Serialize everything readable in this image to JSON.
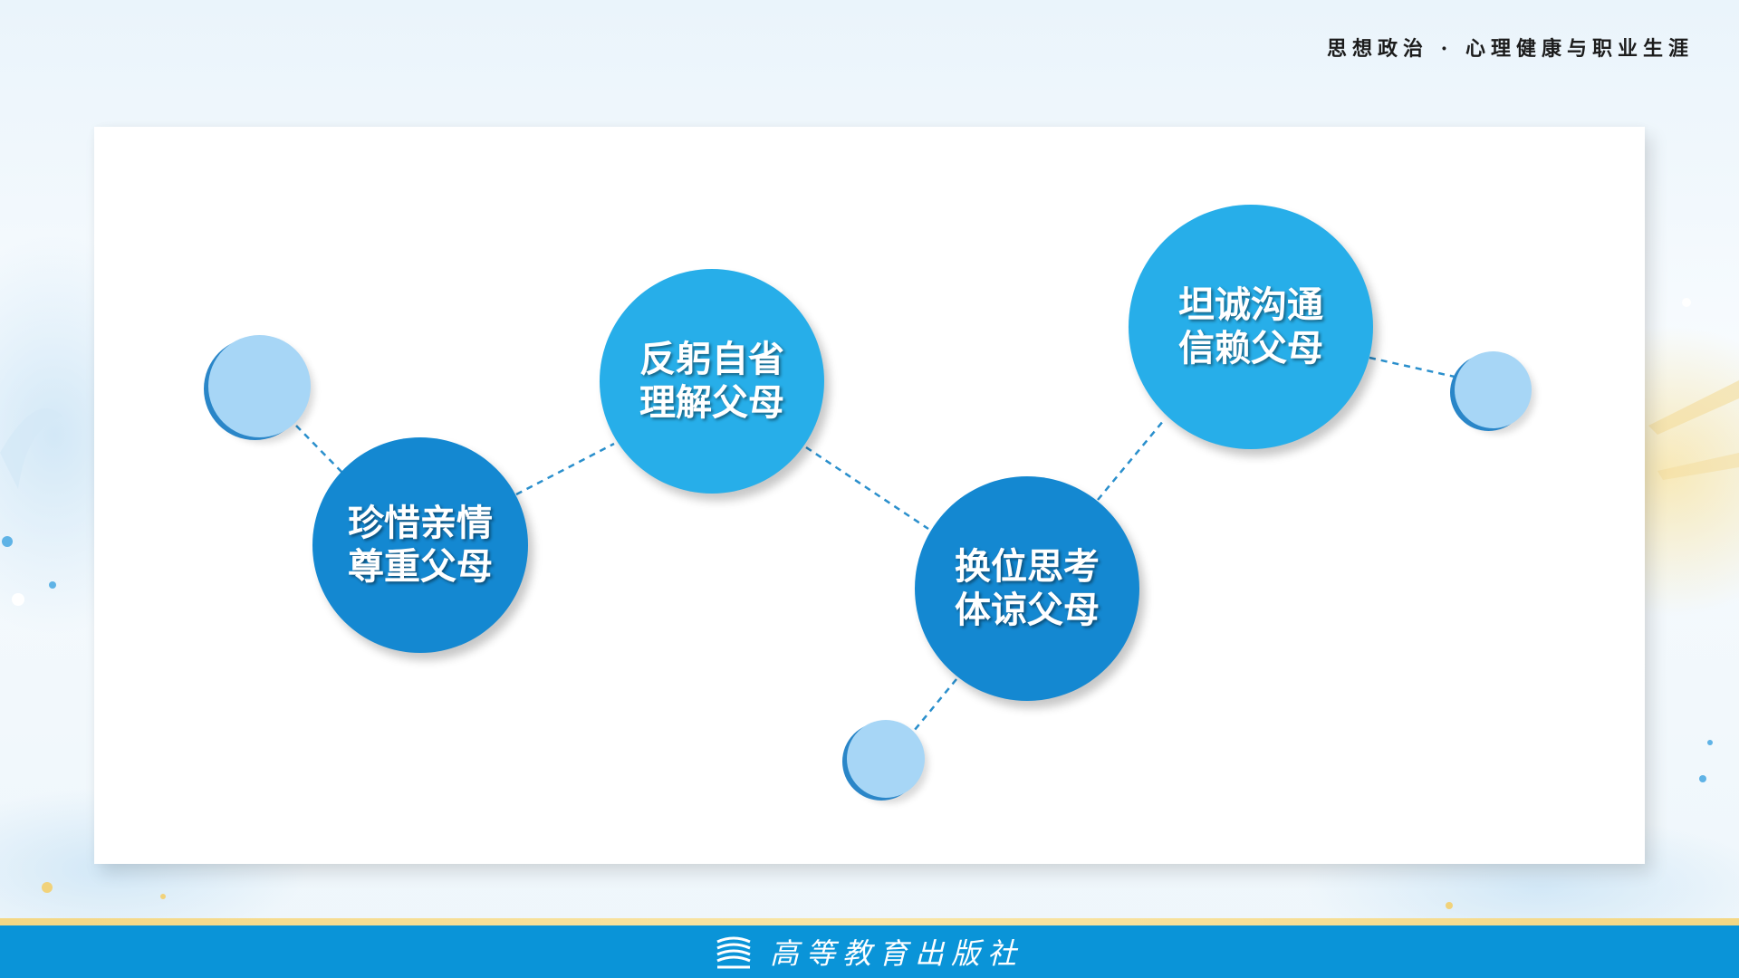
{
  "header": {
    "title": "思想政治 · 心理健康与职业生涯"
  },
  "nodes": [
    {
      "id": "cherish",
      "line1": "珍惜亲情",
      "line2": "尊重父母"
    },
    {
      "id": "reflect",
      "line1": "反躬自省",
      "line2": "理解父母"
    },
    {
      "id": "empathy",
      "line1": "换位思考",
      "line2": "体谅父母"
    },
    {
      "id": "communicate",
      "line1": "坦诚沟通",
      "line2": "信赖父母"
    }
  ],
  "footer": {
    "publisher": "高等教育出版社"
  },
  "colors": {
    "node_dark": "#1488d1",
    "node_light": "#27aee9",
    "dot": "#a7d6f6",
    "footer_bar": "#0a94d8",
    "gold_stripe": "#f4d784",
    "frame_line": "#2c9ad6"
  }
}
